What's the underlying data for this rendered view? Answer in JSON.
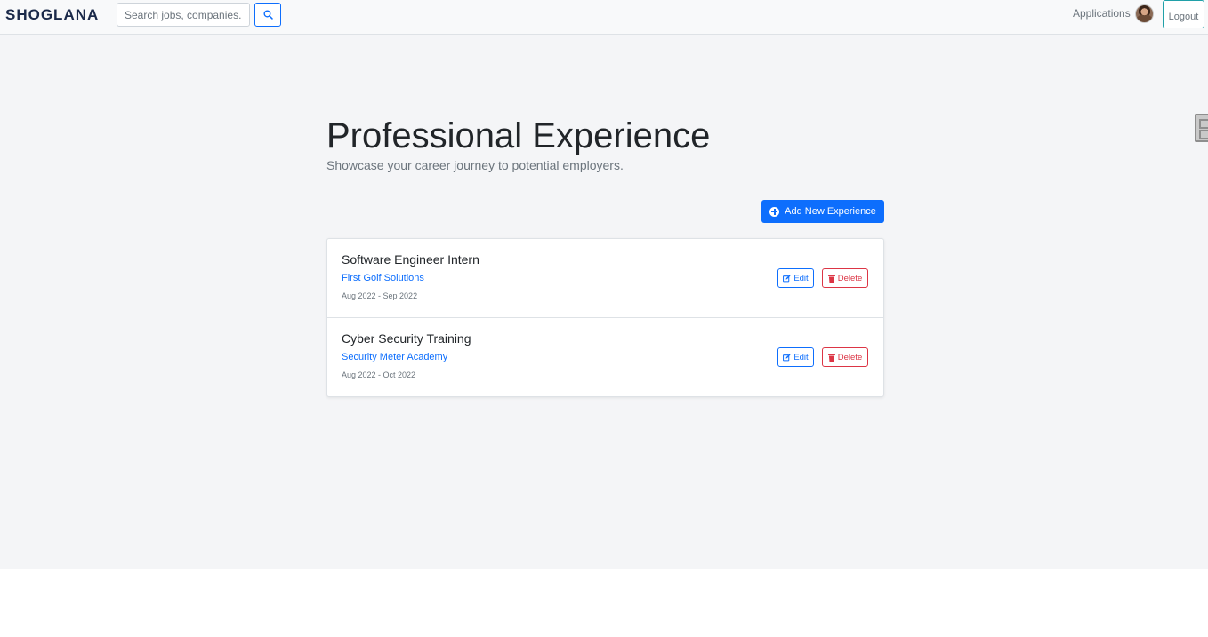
{
  "navbar": {
    "brand": "SHOGLANA",
    "search_placeholder": "Search jobs, companies...",
    "search_icon": "search-icon",
    "links": [
      {
        "label": "Applications"
      }
    ],
    "logout_label": "Logout"
  },
  "page": {
    "title": "Professional Experience",
    "subtitle": "Showcase your career journey to potential employers.",
    "add_button_label": "Add New Experience",
    "add_button_icon": "plus-circle-icon"
  },
  "experiences": [
    {
      "title": "Software Engineer Intern",
      "company": "First Golf Solutions",
      "dates": "Aug 2022 - Sep 2022",
      "edit_label": "Edit",
      "delete_label": "Delete"
    },
    {
      "title": "Cyber Security Training",
      "company": "Security Meter Academy",
      "dates": "Aug 2022 - Oct 2022",
      "edit_label": "Edit",
      "delete_label": "Delete"
    }
  ],
  "colors": {
    "primary": "#0d6efd",
    "danger": "#dc3545",
    "brand": "#1b2a4a",
    "background": "#f4f5f7"
  }
}
